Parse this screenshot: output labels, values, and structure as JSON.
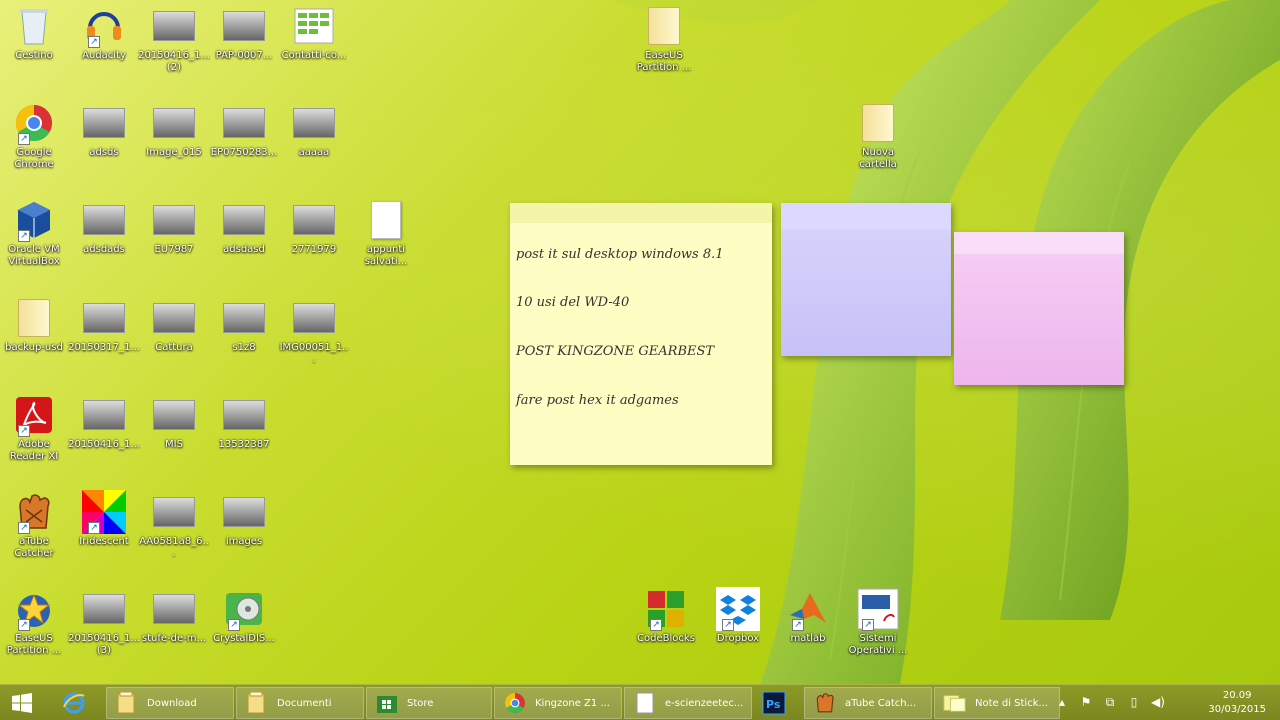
{
  "desktop_icons": [
    {
      "label": "Cestino",
      "icon": "recycle-bin-icon"
    },
    {
      "label": "Audacity",
      "icon": "audacity-icon"
    },
    {
      "label": "20150416_1...\n(2)",
      "icon": "image-file-icon"
    },
    {
      "label": "PAP-0007...",
      "icon": "image-file-icon"
    },
    {
      "label": "Contatti-co...",
      "icon": "spreadsheet-file-icon"
    },
    {
      "label": "Google\nChrome",
      "icon": "chrome-icon"
    },
    {
      "label": "adsds",
      "icon": "image-file-icon"
    },
    {
      "label": "Image_015",
      "icon": "image-file-icon"
    },
    {
      "label": "EP0750283...",
      "icon": "image-file-icon"
    },
    {
      "label": "aaaaa",
      "icon": "image-file-icon"
    },
    {
      "label": "Oracle VM\nVirtualBox",
      "icon": "virtualbox-icon"
    },
    {
      "label": "adsdads",
      "icon": "image-file-icon"
    },
    {
      "label": "EU7987",
      "icon": "image-file-icon"
    },
    {
      "label": "adsdasd",
      "icon": "image-file-icon"
    },
    {
      "label": "2771979",
      "icon": "image-file-icon"
    },
    {
      "label": "appunti\nsalvati...",
      "icon": "text-file-icon"
    },
    {
      "label": "backup-usd",
      "icon": "folder-icon"
    },
    {
      "label": "20150317_1...",
      "icon": "image-file-icon"
    },
    {
      "label": "Cattura",
      "icon": "image-file-icon"
    },
    {
      "label": "s1z8",
      "icon": "image-file-icon"
    },
    {
      "label": "IMG00051_1...",
      "icon": "image-file-icon"
    },
    {
      "label": "Adobe\nReader XI",
      "icon": "adobe-reader-icon"
    },
    {
      "label": "20150416_1...",
      "icon": "image-file-icon"
    },
    {
      "label": "MIS",
      "icon": "image-file-icon"
    },
    {
      "label": "13532387",
      "icon": "image-file-icon"
    },
    {
      "label": "aTube\nCatcher",
      "icon": "atube-catcher-icon"
    },
    {
      "label": "Iridescent",
      "icon": "color-wheel-icon"
    },
    {
      "label": "AA0581a8_6...",
      "icon": "image-file-icon"
    },
    {
      "label": "images",
      "icon": "image-file-icon"
    },
    {
      "label": "EaseUS\nPartition ...",
      "icon": "easeus-icon"
    },
    {
      "label": "20150416_1...\n(3)",
      "icon": "image-file-icon"
    },
    {
      "label": "stufe-de-m...",
      "icon": "image-file-icon"
    },
    {
      "label": "CrystalDIS...",
      "icon": "crystaldisk-icon"
    },
    {
      "label": "EaseUS\nPartition ...",
      "icon": "folder-icon"
    },
    {
      "label": "Nuova\ncartella",
      "icon": "folder-icon"
    },
    {
      "label": "CodeBlocks",
      "icon": "codeblocks-icon"
    },
    {
      "label": "Dropbox",
      "icon": "dropbox-icon"
    },
    {
      "label": "matlab",
      "icon": "matlab-icon"
    },
    {
      "label": "Sistemi\nOperativi ...",
      "icon": "pdf-file-icon"
    }
  ],
  "sticky_notes": {
    "yellow": {
      "lines": [
        "post it sul desktop windows 8.1",
        "10 usi del WD-40",
        "POST KINGZONE GEARBEST",
        "fare post hex it adgames"
      ]
    },
    "purple": {
      "text": ""
    },
    "pink": {
      "text": ""
    }
  },
  "taskbar": {
    "start_icon": "windows-logo-icon",
    "pinned_icon": "internet-explorer-icon",
    "buttons": [
      {
        "label": "Download",
        "icon": "folder-icon"
      },
      {
        "label": "Documenti",
        "icon": "folder-icon"
      },
      {
        "label": "Store",
        "icon": "store-icon"
      },
      {
        "label": "Kingzone Z1 ...",
        "icon": "chrome-icon"
      },
      {
        "label": "e-scienzeetec...",
        "icon": "document-icon"
      },
      {
        "label": "",
        "icon": "photoshop-icon"
      },
      {
        "label": "aTube Catch...",
        "icon": "atube-catcher-icon"
      },
      {
        "label": "Note di Stick...",
        "icon": "sticky-notes-icon"
      }
    ],
    "tray": {
      "icons": [
        "show-hidden-icon",
        "flag-icon",
        "network-icon",
        "power-icon",
        "volume-icon"
      ],
      "time": "20.09",
      "date": "30/03/2015"
    }
  },
  "colors": {
    "desktop": "#c4da25",
    "taskbar": "#86921f",
    "note_yellow": "#fdfdc4",
    "note_purple": "#d0cbf9",
    "note_pink": "#f1c0f0"
  }
}
